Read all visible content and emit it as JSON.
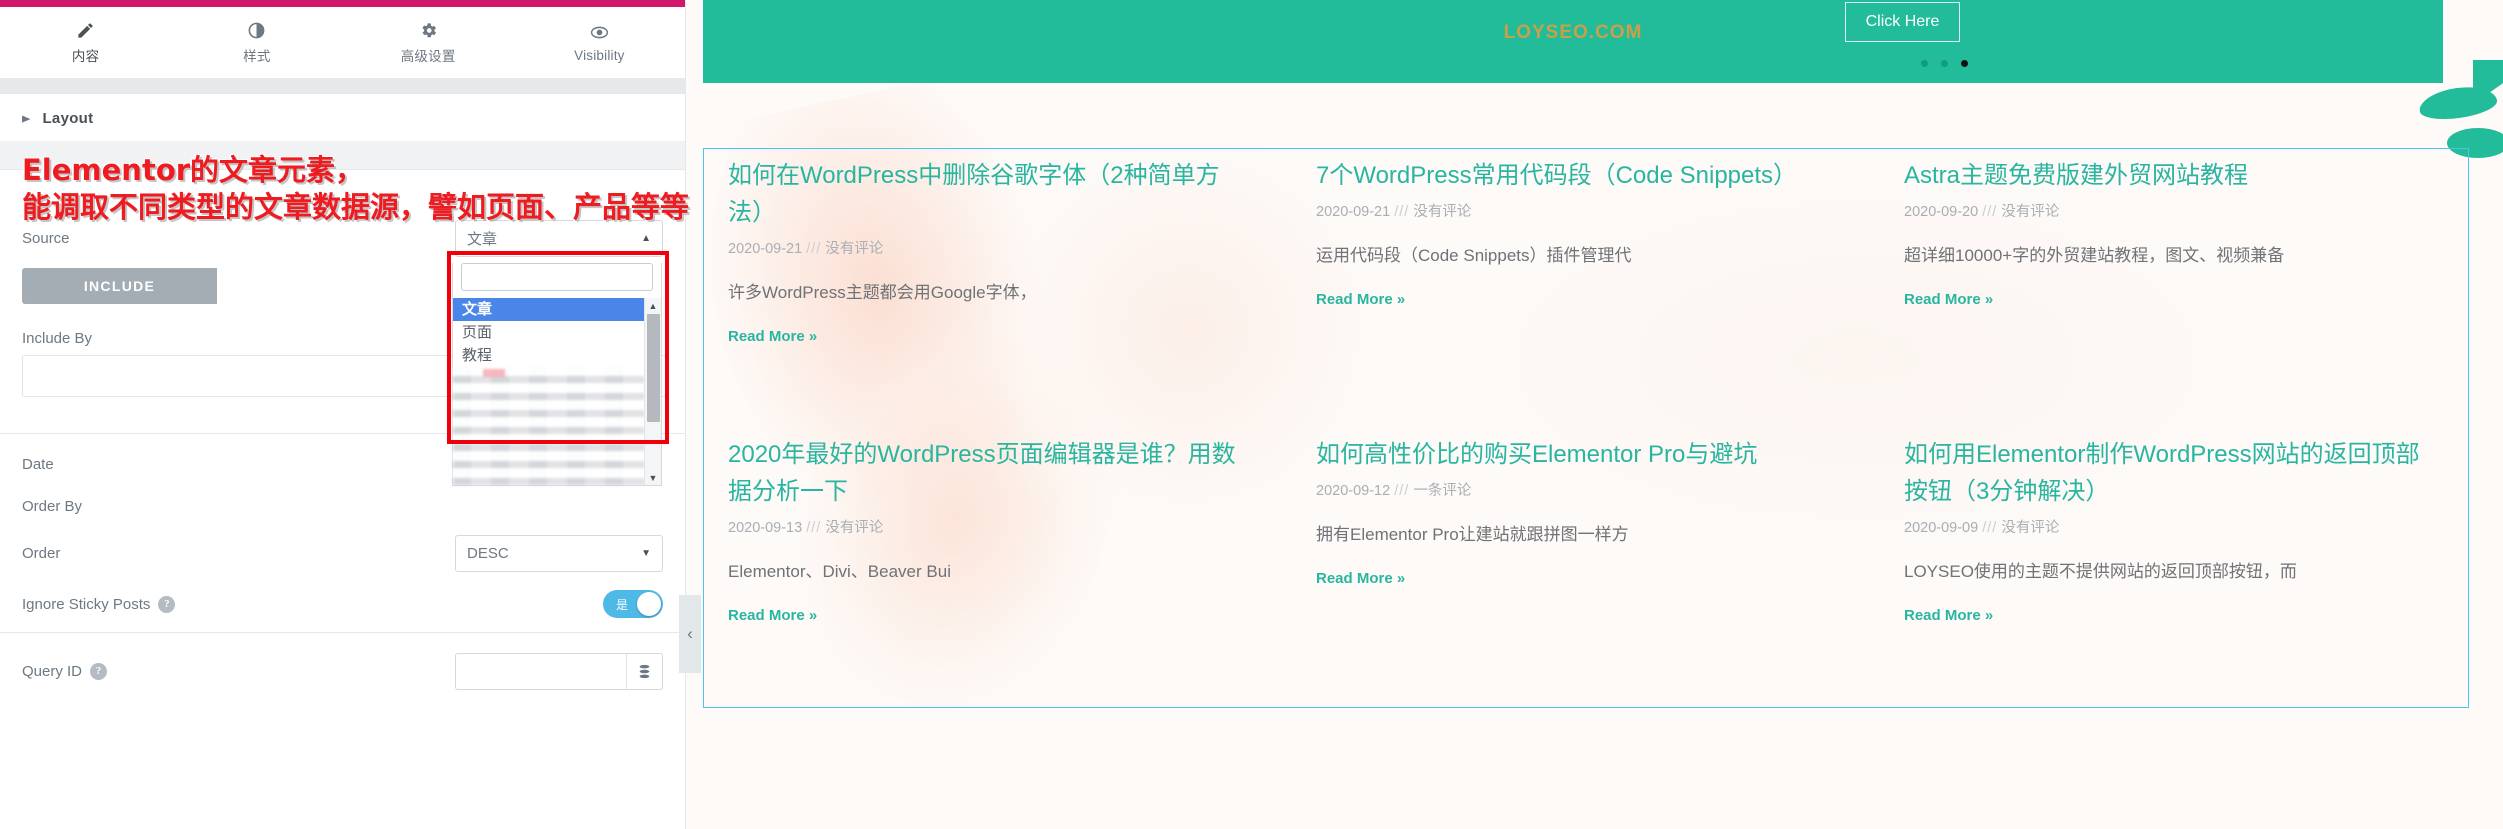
{
  "panel": {
    "tabs": [
      {
        "label": "内容",
        "icon": "pencil-icon",
        "active": true
      },
      {
        "label": "样式",
        "icon": "contrast-icon",
        "active": false
      },
      {
        "label": "高级设置",
        "icon": "gear-icon",
        "active": false
      },
      {
        "label": "Visibility",
        "icon": "eye-icon",
        "active": false
      }
    ],
    "section_title": "Layout",
    "source": {
      "label": "Source",
      "value": "文章",
      "search_value": "",
      "options": [
        "文章",
        "页面",
        "教程"
      ],
      "selected_index": 0
    },
    "include": {
      "tab_label": "INCLUDE",
      "include_by_label": "Include By",
      "include_by_value": ""
    },
    "date_label": "Date",
    "order_by_label": "Order By",
    "order": {
      "label": "Order",
      "value": "DESC"
    },
    "ignore_sticky": {
      "label": "Ignore Sticky Posts",
      "state_label": "是",
      "on": true
    },
    "query_id": {
      "label": "Query ID",
      "value": "",
      "placeholder": ""
    }
  },
  "annotation": {
    "line1": "Elementor的文章元素，",
    "line2": "能调取不同类型的文章数据源，譬如页面、产品等等",
    "color": "#ee1b20"
  },
  "preview": {
    "hero": {
      "logo": "LOYSEO.COM",
      "button_label": "Click Here",
      "dots": 3,
      "active_dot": 2,
      "bg_color": "#22bc9a"
    },
    "accent_color": "#2ab5a0",
    "posts": [
      {
        "title": "如何在WordPress中删除谷歌字体（2种简单方法）",
        "date": "2020-09-21",
        "comments": "没有评论",
        "excerpt": "许多WordPress主题都会用Google字体，",
        "read_more": "Read More »"
      },
      {
        "title": "7个WordPress常用代码段（Code Snippets）",
        "date": "2020-09-21",
        "comments": "没有评论",
        "excerpt": "运用代码段（Code Snippets）插件管理代",
        "read_more": "Read More »"
      },
      {
        "title": "Astra主题免费版建外贸网站教程",
        "date": "2020-09-20",
        "comments": "没有评论",
        "excerpt": "超详细10000+字的外贸建站教程，图文、视频兼备",
        "read_more": "Read More »"
      },
      {
        "title": "2020年最好的WordPress页面编辑器是谁？用数据分析一下",
        "date": "2020-09-13",
        "comments": "没有评论",
        "excerpt": "Elementor、Divi、Beaver Bui",
        "read_more": "Read More »"
      },
      {
        "title": "如何高性价比的购买Elementor Pro与避坑",
        "date": "2020-09-12",
        "comments": "一条评论",
        "excerpt": "拥有Elementor Pro让建站就跟拼图一样方",
        "read_more": "Read More »"
      },
      {
        "title": "如何用Elementor制作WordPress网站的返回顶部按钮（3分钟解决）",
        "date": "2020-09-09",
        "comments": "没有评论",
        "excerpt": "LOYSEO使用的主题不提供网站的返回顶部按钮，而",
        "read_more": "Read More »"
      }
    ],
    "meta_separator": "///",
    "collapse_handle": "‹"
  }
}
